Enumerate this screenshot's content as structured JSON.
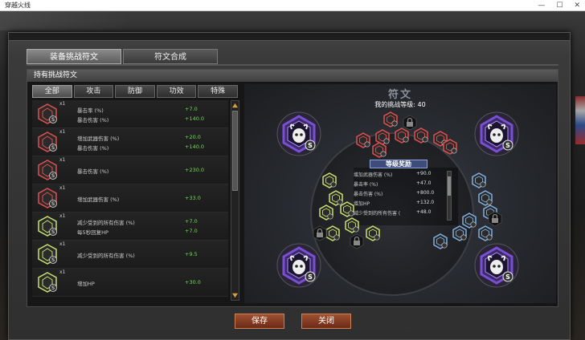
{
  "window": {
    "title": "穿越火线",
    "controls": [
      "—",
      "☐",
      "✕"
    ]
  },
  "tabs": [
    {
      "label": "装备挑战符文",
      "active": true
    },
    {
      "label": "符文合成",
      "active": false
    }
  ],
  "panel": {
    "header": "持有挑战符文"
  },
  "filters": [
    {
      "label": "全部",
      "active": true
    },
    {
      "label": "攻击",
      "active": false
    },
    {
      "label": "防御",
      "active": false
    },
    {
      "label": "功效",
      "active": false
    },
    {
      "label": "特殊",
      "active": false
    }
  ],
  "runes": [
    {
      "count": "x1",
      "color": "#e05050",
      "lines": [
        {
          "label": "暴击率 (%)",
          "value": "+7.0"
        },
        {
          "label": "暴击伤害 (%)",
          "value": "+140.0"
        }
      ]
    },
    {
      "count": "x1",
      "color": "#e05050",
      "lines": [
        {
          "label": "增加武器伤害 (%)",
          "value": "+20.0"
        },
        {
          "label": "暴击伤害 (%)",
          "value": "+140.0"
        }
      ]
    },
    {
      "count": "x1",
      "color": "#e05050",
      "lines": [
        {
          "label": "暴击伤害 (%)",
          "value": "+230.0"
        }
      ]
    },
    {
      "count": "x1",
      "color": "#e05050",
      "lines": [
        {
          "label": "增加武器伤害 (%)",
          "value": "+33.0"
        }
      ]
    },
    {
      "count": "x1",
      "color": "#c8e070",
      "lines": [
        {
          "label": "减少受到的所有伤害 (%)",
          "value": "+7.0"
        },
        {
          "label": "每5秒回复HP",
          "value": "+7.0"
        }
      ]
    },
    {
      "count": "x1",
      "color": "#c8e070",
      "lines": [
        {
          "label": "减少受到的所有伤害 (%)",
          "value": "+9.5"
        }
      ]
    },
    {
      "count": "x1",
      "color": "#c8e070",
      "lines": [
        {
          "label": "增加HP",
          "value": "+30.0"
        }
      ]
    }
  ],
  "board": {
    "title": "符文",
    "challenge_level_label": "我的挑战等级: 40",
    "reward_title": "等级奖励",
    "rewards": [
      {
        "label": "增加武器伤害 (%)",
        "value": "+90.0"
      },
      {
        "label": "暴击率 (%)",
        "value": "+47.0"
      },
      {
        "label": "暴击伤害 (%)",
        "value": "+800.0"
      },
      {
        "label": "增加HP",
        "value": "+132.0"
      },
      {
        "label": "减少受到的所有伤害 (",
        "value": "+48.0"
      }
    ],
    "colors": {
      "attack": "#e05050",
      "defense": "#c8e070",
      "special": "#7fb0e0",
      "purple": "#7a4fd0"
    }
  },
  "buttons": {
    "save": "保存",
    "close": "关闭"
  }
}
